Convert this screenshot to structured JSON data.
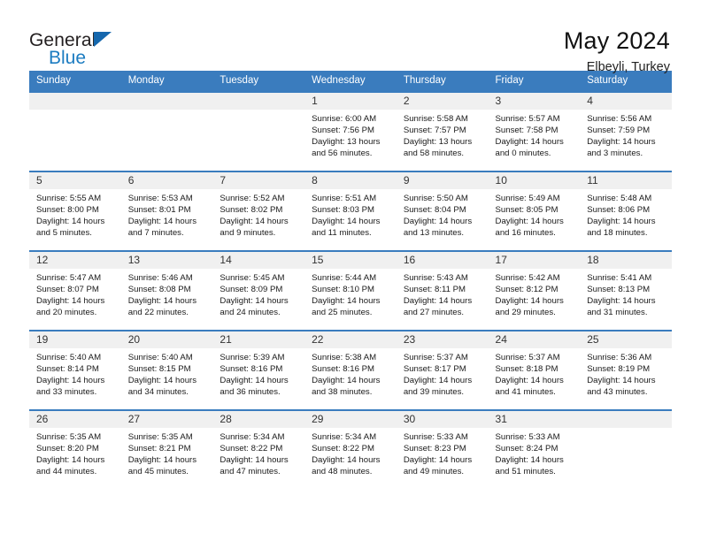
{
  "brand": {
    "name_top": "General",
    "name_bottom": "Blue",
    "accent_color": "#1c7cc1"
  },
  "header": {
    "title": "May 2024",
    "subtitle": "Elbeyli, Turkey"
  },
  "theme": {
    "header_blue": "#3a7cbe",
    "daynum_bg": "#f0f0f0"
  },
  "calendar": {
    "weekday_headers": [
      "Sunday",
      "Monday",
      "Tuesday",
      "Wednesday",
      "Thursday",
      "Friday",
      "Saturday"
    ],
    "labels": {
      "sunrise": "Sunrise:",
      "sunset": "Sunset:",
      "daylight": "Daylight:"
    },
    "weeks": [
      [
        {
          "day": "",
          "empty": true
        },
        {
          "day": "",
          "empty": true
        },
        {
          "day": "",
          "empty": true
        },
        {
          "day": "1",
          "sunrise": "Sunrise: 6:00 AM",
          "sunset": "Sunset: 7:56 PM",
          "daylight_1": "Daylight: 13 hours",
          "daylight_2": "and 56 minutes."
        },
        {
          "day": "2",
          "sunrise": "Sunrise: 5:58 AM",
          "sunset": "Sunset: 7:57 PM",
          "daylight_1": "Daylight: 13 hours",
          "daylight_2": "and 58 minutes."
        },
        {
          "day": "3",
          "sunrise": "Sunrise: 5:57 AM",
          "sunset": "Sunset: 7:58 PM",
          "daylight_1": "Daylight: 14 hours",
          "daylight_2": "and 0 minutes."
        },
        {
          "day": "4",
          "sunrise": "Sunrise: 5:56 AM",
          "sunset": "Sunset: 7:59 PM",
          "daylight_1": "Daylight: 14 hours",
          "daylight_2": "and 3 minutes."
        }
      ],
      [
        {
          "day": "5",
          "sunrise": "Sunrise: 5:55 AM",
          "sunset": "Sunset: 8:00 PM",
          "daylight_1": "Daylight: 14 hours",
          "daylight_2": "and 5 minutes."
        },
        {
          "day": "6",
          "sunrise": "Sunrise: 5:53 AM",
          "sunset": "Sunset: 8:01 PM",
          "daylight_1": "Daylight: 14 hours",
          "daylight_2": "and 7 minutes."
        },
        {
          "day": "7",
          "sunrise": "Sunrise: 5:52 AM",
          "sunset": "Sunset: 8:02 PM",
          "daylight_1": "Daylight: 14 hours",
          "daylight_2": "and 9 minutes."
        },
        {
          "day": "8",
          "sunrise": "Sunrise: 5:51 AM",
          "sunset": "Sunset: 8:03 PM",
          "daylight_1": "Daylight: 14 hours",
          "daylight_2": "and 11 minutes."
        },
        {
          "day": "9",
          "sunrise": "Sunrise: 5:50 AM",
          "sunset": "Sunset: 8:04 PM",
          "daylight_1": "Daylight: 14 hours",
          "daylight_2": "and 13 minutes."
        },
        {
          "day": "10",
          "sunrise": "Sunrise: 5:49 AM",
          "sunset": "Sunset: 8:05 PM",
          "daylight_1": "Daylight: 14 hours",
          "daylight_2": "and 16 minutes."
        },
        {
          "day": "11",
          "sunrise": "Sunrise: 5:48 AM",
          "sunset": "Sunset: 8:06 PM",
          "daylight_1": "Daylight: 14 hours",
          "daylight_2": "and 18 minutes."
        }
      ],
      [
        {
          "day": "12",
          "sunrise": "Sunrise: 5:47 AM",
          "sunset": "Sunset: 8:07 PM",
          "daylight_1": "Daylight: 14 hours",
          "daylight_2": "and 20 minutes."
        },
        {
          "day": "13",
          "sunrise": "Sunrise: 5:46 AM",
          "sunset": "Sunset: 8:08 PM",
          "daylight_1": "Daylight: 14 hours",
          "daylight_2": "and 22 minutes."
        },
        {
          "day": "14",
          "sunrise": "Sunrise: 5:45 AM",
          "sunset": "Sunset: 8:09 PM",
          "daylight_1": "Daylight: 14 hours",
          "daylight_2": "and 24 minutes."
        },
        {
          "day": "15",
          "sunrise": "Sunrise: 5:44 AM",
          "sunset": "Sunset: 8:10 PM",
          "daylight_1": "Daylight: 14 hours",
          "daylight_2": "and 25 minutes."
        },
        {
          "day": "16",
          "sunrise": "Sunrise: 5:43 AM",
          "sunset": "Sunset: 8:11 PM",
          "daylight_1": "Daylight: 14 hours",
          "daylight_2": "and 27 minutes."
        },
        {
          "day": "17",
          "sunrise": "Sunrise: 5:42 AM",
          "sunset": "Sunset: 8:12 PM",
          "daylight_1": "Daylight: 14 hours",
          "daylight_2": "and 29 minutes."
        },
        {
          "day": "18",
          "sunrise": "Sunrise: 5:41 AM",
          "sunset": "Sunset: 8:13 PM",
          "daylight_1": "Daylight: 14 hours",
          "daylight_2": "and 31 minutes."
        }
      ],
      [
        {
          "day": "19",
          "sunrise": "Sunrise: 5:40 AM",
          "sunset": "Sunset: 8:14 PM",
          "daylight_1": "Daylight: 14 hours",
          "daylight_2": "and 33 minutes."
        },
        {
          "day": "20",
          "sunrise": "Sunrise: 5:40 AM",
          "sunset": "Sunset: 8:15 PM",
          "daylight_1": "Daylight: 14 hours",
          "daylight_2": "and 34 minutes."
        },
        {
          "day": "21",
          "sunrise": "Sunrise: 5:39 AM",
          "sunset": "Sunset: 8:16 PM",
          "daylight_1": "Daylight: 14 hours",
          "daylight_2": "and 36 minutes."
        },
        {
          "day": "22",
          "sunrise": "Sunrise: 5:38 AM",
          "sunset": "Sunset: 8:16 PM",
          "daylight_1": "Daylight: 14 hours",
          "daylight_2": "and 38 minutes."
        },
        {
          "day": "23",
          "sunrise": "Sunrise: 5:37 AM",
          "sunset": "Sunset: 8:17 PM",
          "daylight_1": "Daylight: 14 hours",
          "daylight_2": "and 39 minutes."
        },
        {
          "day": "24",
          "sunrise": "Sunrise: 5:37 AM",
          "sunset": "Sunset: 8:18 PM",
          "daylight_1": "Daylight: 14 hours",
          "daylight_2": "and 41 minutes."
        },
        {
          "day": "25",
          "sunrise": "Sunrise: 5:36 AM",
          "sunset": "Sunset: 8:19 PM",
          "daylight_1": "Daylight: 14 hours",
          "daylight_2": "and 43 minutes."
        }
      ],
      [
        {
          "day": "26",
          "sunrise": "Sunrise: 5:35 AM",
          "sunset": "Sunset: 8:20 PM",
          "daylight_1": "Daylight: 14 hours",
          "daylight_2": "and 44 minutes."
        },
        {
          "day": "27",
          "sunrise": "Sunrise: 5:35 AM",
          "sunset": "Sunset: 8:21 PM",
          "daylight_1": "Daylight: 14 hours",
          "daylight_2": "and 45 minutes."
        },
        {
          "day": "28",
          "sunrise": "Sunrise: 5:34 AM",
          "sunset": "Sunset: 8:22 PM",
          "daylight_1": "Daylight: 14 hours",
          "daylight_2": "and 47 minutes."
        },
        {
          "day": "29",
          "sunrise": "Sunrise: 5:34 AM",
          "sunset": "Sunset: 8:22 PM",
          "daylight_1": "Daylight: 14 hours",
          "daylight_2": "and 48 minutes."
        },
        {
          "day": "30",
          "sunrise": "Sunrise: 5:33 AM",
          "sunset": "Sunset: 8:23 PM",
          "daylight_1": "Daylight: 14 hours",
          "daylight_2": "and 49 minutes."
        },
        {
          "day": "31",
          "sunrise": "Sunrise: 5:33 AM",
          "sunset": "Sunset: 8:24 PM",
          "daylight_1": "Daylight: 14 hours",
          "daylight_2": "and 51 minutes."
        },
        {
          "day": "",
          "empty": true
        }
      ]
    ]
  }
}
